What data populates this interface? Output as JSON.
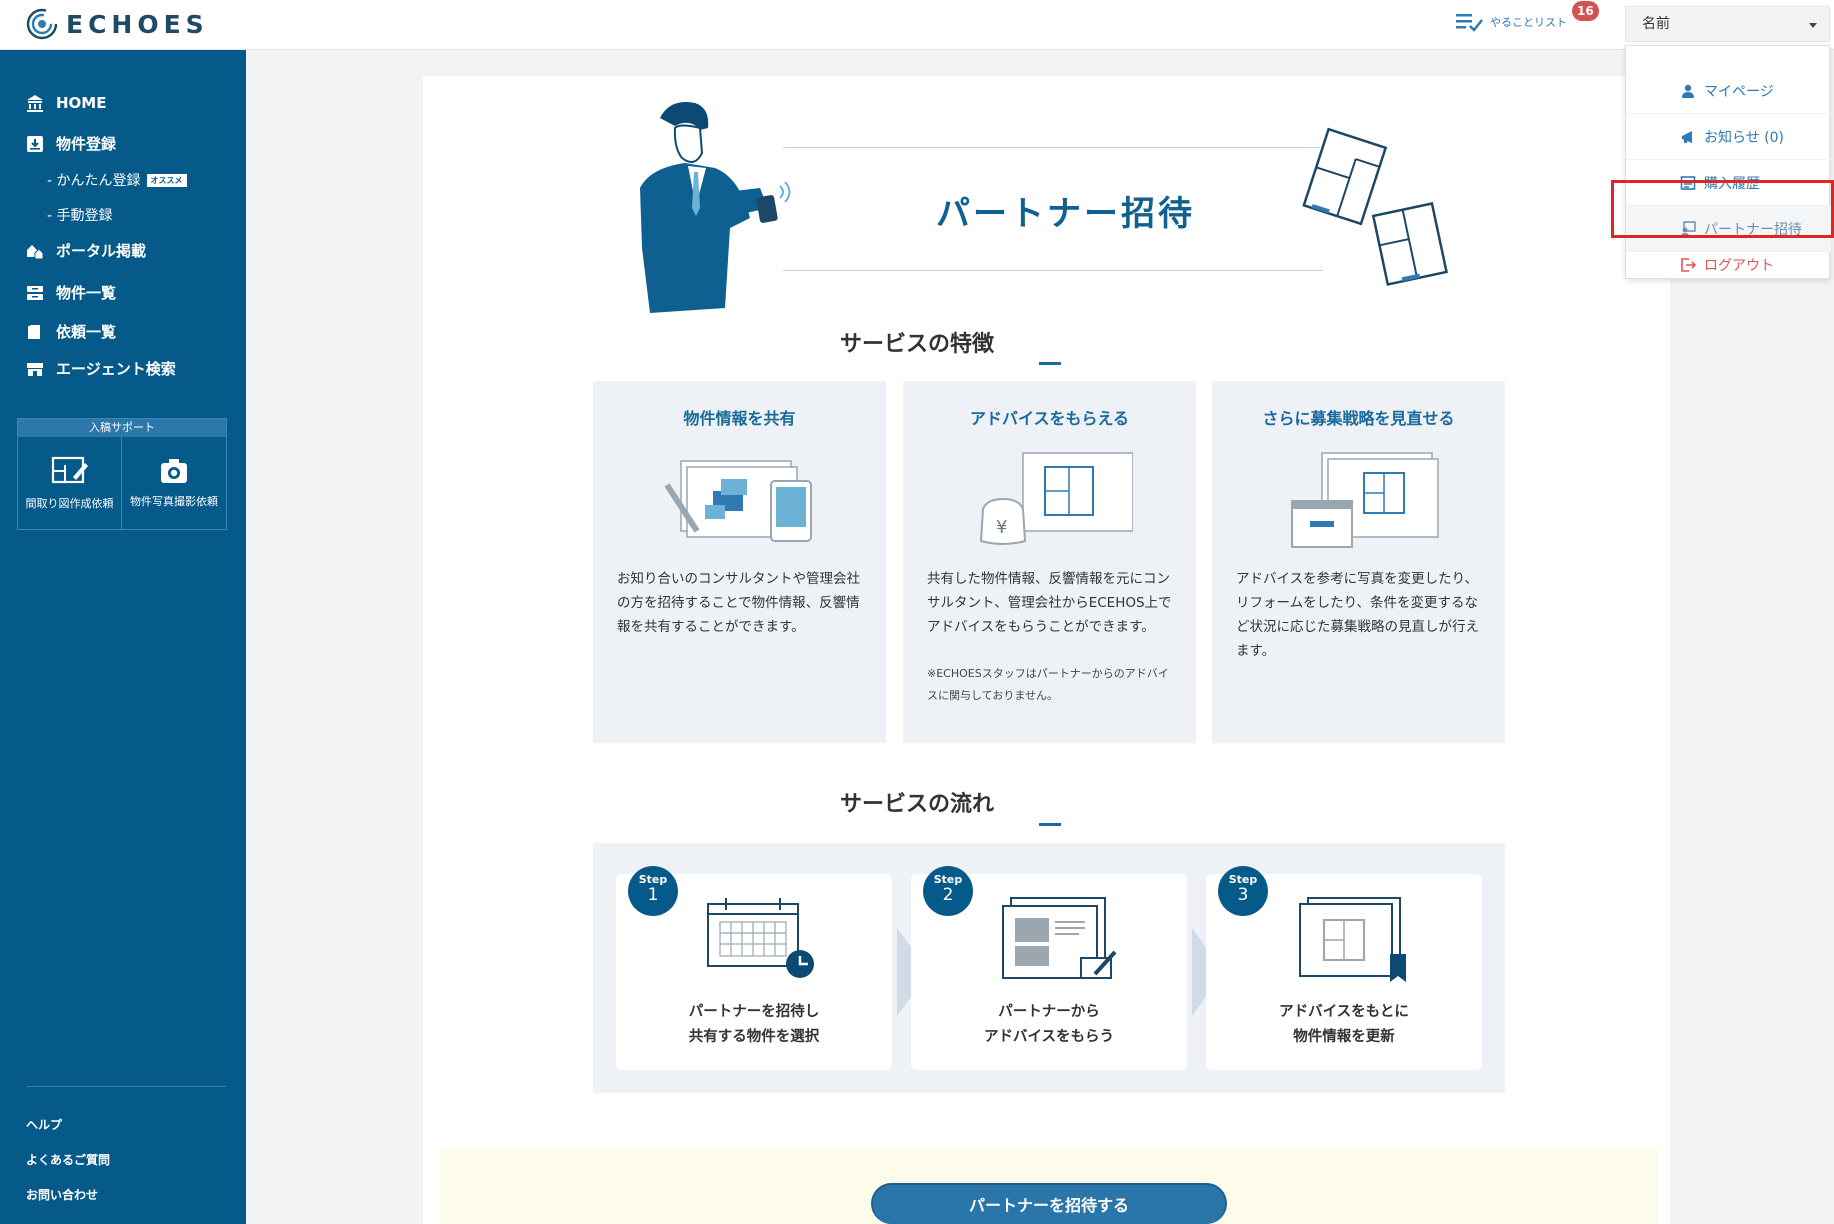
{
  "app": {
    "logo_text": "ECHOES"
  },
  "header": {
    "todo_label": "やることリスト",
    "todo_count": "16",
    "user_name": "名前"
  },
  "user_menu": {
    "items": [
      {
        "label": "マイページ",
        "icon": "person-icon"
      },
      {
        "label": "お知らせ (0)",
        "icon": "megaphone-icon"
      },
      {
        "label": "購入履歴",
        "icon": "receipt-icon"
      },
      {
        "label": "パートナー招待",
        "icon": "partner-icon",
        "highlighted": true
      },
      {
        "label": "ログアウト",
        "icon": "logout-icon"
      }
    ],
    "highlight_color": "#e02525"
  },
  "sidebar": {
    "items": [
      {
        "label": "HOME",
        "icon": "bank-icon"
      },
      {
        "label": "物件登録",
        "icon": "download-box-icon"
      },
      {
        "label": "ポータル掲載",
        "icon": "houses-icon"
      },
      {
        "label": "物件一覧",
        "icon": "inbox-icon"
      },
      {
        "label": "依頼一覧",
        "icon": "book-icon"
      },
      {
        "label": "エージェント検索",
        "icon": "store-icon"
      }
    ],
    "sub_items": [
      {
        "label": "- かんたん登録",
        "badge": "オススメ"
      },
      {
        "label": "- 手動登録"
      }
    ],
    "support": {
      "heading": "入稿サポート",
      "tiles": [
        {
          "label": "間取り図作成依頼",
          "icon": "floorplan-edit-icon"
        },
        {
          "label": "物件写真撮影依頼",
          "icon": "camera-icon"
        }
      ]
    },
    "footer_links": [
      "ヘルプ",
      "よくあるご質問",
      "お問い合わせ"
    ]
  },
  "main": {
    "hero_title": "パートナー招待",
    "features_heading": "サービスの特徴",
    "features": [
      {
        "title": "物件情報を共有",
        "text": "お知り合いのコンサルタントや管理会社の方を招待することで物件情報、反響情報を共有することができます。",
        "note": ""
      },
      {
        "title": "アドバイスをもらえる",
        "text": "共有した物件情報、反響情報を元にコンサルタント、管理会社からECEHOS上でアドバイスをもらうことができます。",
        "note": "※ECHOESスタッフはパートナーからのアドバイスに関与しておりません。"
      },
      {
        "title": "さらに募集戦略を見直せる",
        "text": "アドバイスを参考に写真を変更したり、リフォームをしたり、条件を変更するなど状況に応じた募集戦略の見直しが行えます。",
        "note": ""
      }
    ],
    "flow_heading": "サービスの流れ",
    "steps": [
      {
        "word": "Step",
        "num": "1",
        "line1": "パートナーを招待し",
        "line2": "共有する物件を選択"
      },
      {
        "word": "Step",
        "num": "2",
        "line1": "パートナーから",
        "line2": "アドバイスをもらう"
      },
      {
        "word": "Step",
        "num": "3",
        "line1": "アドバイスをもとに",
        "line2": "物件情報を更新"
      }
    ],
    "cta_label": "パートナーを招待する"
  },
  "colors": {
    "sidebar": "#065a8a",
    "accent": "#1a6a9c",
    "badge": "#d35353",
    "logout": "#e0565a"
  }
}
